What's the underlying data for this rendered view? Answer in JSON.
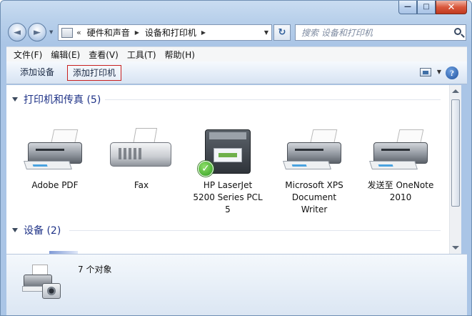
{
  "window": {
    "caption_buttons": {
      "minimize_glyph": "—",
      "maximize_glyph": "□",
      "close_glyph": "✕"
    }
  },
  "nav": {
    "back_glyph": "◄",
    "forward_glyph": "►",
    "address": {
      "separator": "«",
      "crumbs": [
        "硬件和声音",
        "设备和打印机"
      ],
      "crumb_arrow": "▶"
    },
    "refresh_glyph": "↻",
    "search_placeholder": "搜索 设备和打印机"
  },
  "menubar": {
    "items": [
      "文件(F)",
      "编辑(E)",
      "查看(V)",
      "工具(T)",
      "帮助(H)"
    ]
  },
  "commandbar": {
    "add_device": "添加设备",
    "add_printer": "添加打印机",
    "help_glyph": "?"
  },
  "content": {
    "groups": {
      "printers_title": "打印机和传真 (5)",
      "devices_title": "设备 (2)"
    },
    "printers": [
      {
        "label": "Adobe PDF",
        "icon": "printer-icon"
      },
      {
        "label": "Fax",
        "icon": "fax-icon"
      },
      {
        "label": "HP LaserJet 5200 Series PCL 5",
        "icon": "laserjet-printer-icon",
        "default": true
      },
      {
        "label": "Microsoft XPS Document Writer",
        "icon": "printer-icon"
      },
      {
        "label": "发送至 OneNote 2010",
        "icon": "printer-icon"
      }
    ]
  },
  "details": {
    "count_text": "7 个对象"
  },
  "colors": {
    "accent": "#1e3287",
    "highlight_border": "#c8201f",
    "default_check": "#2f9b1f"
  }
}
